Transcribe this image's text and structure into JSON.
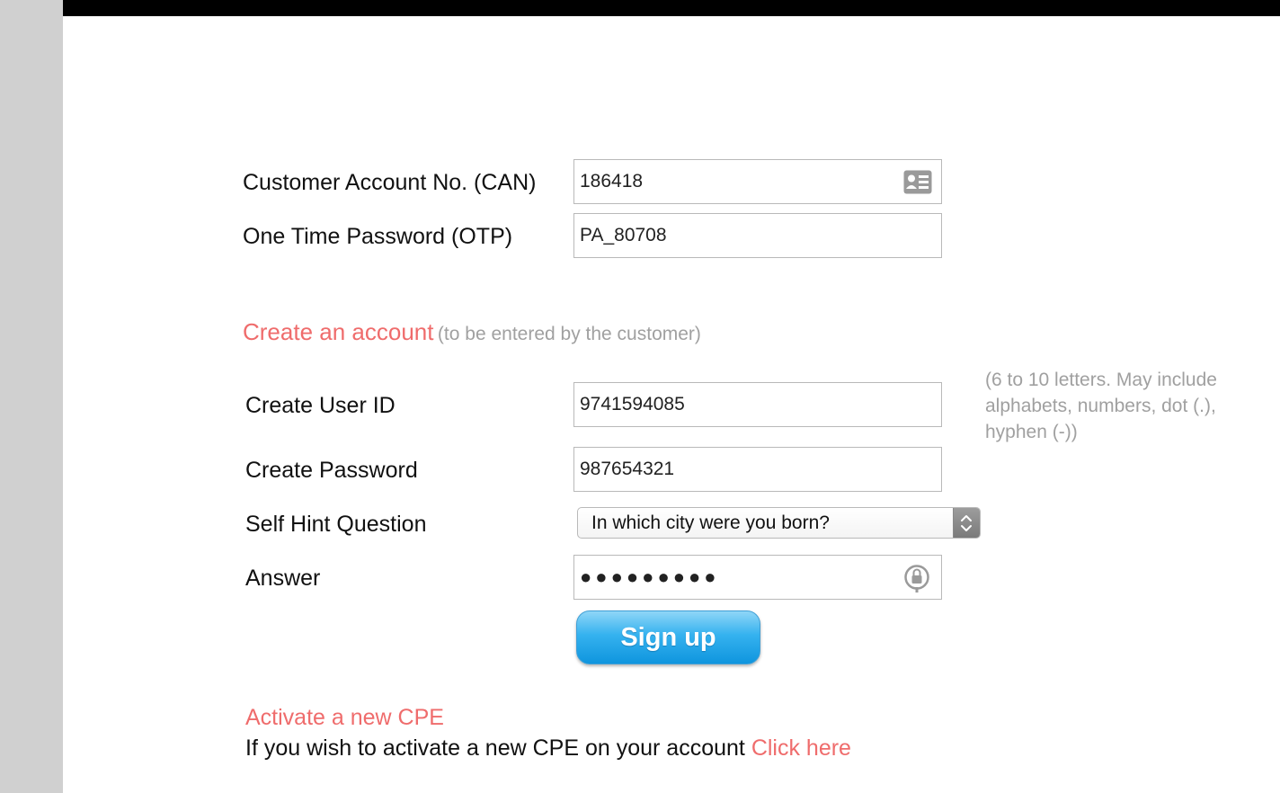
{
  "colors": {
    "accent": "#ef6c6c",
    "muted": "#a0a0a0",
    "button": "#1aa3e8",
    "gutter": "#d0d0d0",
    "top_bar": "#000000"
  },
  "verify": {
    "can_label": "Customer Account No. (CAN)",
    "can_value": "186418",
    "can_icon": "contact-card-icon",
    "otp_label": "One Time Password (OTP)",
    "otp_value": "PA_80708"
  },
  "create_account": {
    "heading": "Create an account",
    "note": "(to be entered by the customer)",
    "user_id_label": "Create User ID",
    "user_id_value": "9741594085",
    "user_id_hint": "(6 to 10 letters. May include alphabets, numbers, dot (.), hyphen (-))",
    "password_label": "Create Password",
    "password_value": "987654321",
    "hint_question_label": "Self Hint Question",
    "hint_question_value": "In which city were you born?",
    "answer_label": "Answer",
    "answer_value": "●●●●●●●●●",
    "answer_icon": "keychain-icon",
    "signup_label": "Sign up"
  },
  "cpe": {
    "heading": "Activate a new CPE",
    "text": "If you wish to activate a new CPE on your account",
    "link_label": "Click here"
  }
}
